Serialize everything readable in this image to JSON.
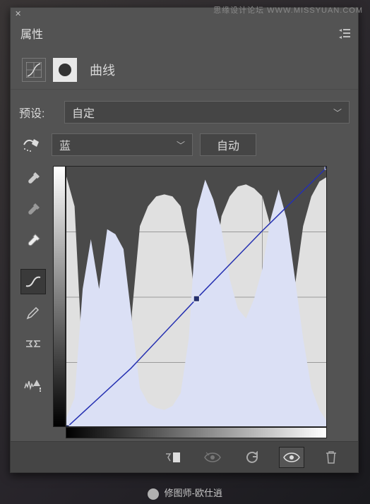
{
  "watermark": "思缘设计论坛  WWW.MISSYUAN.COM",
  "header": {
    "tab_label": "属性"
  },
  "type_row": {
    "label": "曲线"
  },
  "preset": {
    "label": "预设:",
    "value": "自定"
  },
  "channel": {
    "value": "蓝",
    "auto_label": "自动"
  },
  "tools": {
    "eyedrop_black": "black-point",
    "eyedrop_gray": "gray-point",
    "eyedrop_white": "white-point",
    "point_curve": "point-curve",
    "pencil": "draw-curve",
    "smooth": "smooth-curve",
    "clip_warn": "clipping-warn"
  },
  "footer": {
    "clip_adj": "clip-adjust",
    "view_prev": "view-prev-state",
    "reset": "reset",
    "visibility": "toggle-visibility",
    "delete": "delete"
  },
  "credit": "修图师-欧仕逍",
  "chart_data": {
    "type": "curve_histogram",
    "title": "Curves Adjustment – Blue Channel",
    "x_range": [
      0,
      255
    ],
    "y_range": [
      0,
      255
    ],
    "grid": {
      "x_divisions": 4,
      "y_divisions": 4
    },
    "histogram_top": [
      10,
      40,
      200,
      250,
      245,
      248,
      245,
      230,
      150,
      60,
      40,
      30,
      28,
      30,
      40,
      80,
      150,
      180,
      110,
      50,
      30,
      20,
      18,
      22,
      30,
      60,
      110,
      150,
      120,
      60,
      30,
      15,
      10
    ],
    "histogram_light": [
      10,
      30,
      140,
      190,
      140,
      200,
      195,
      180,
      110,
      40,
      25,
      20,
      18,
      22,
      35,
      90,
      220,
      250,
      230,
      200,
      150,
      120,
      110,
      130,
      160,
      210,
      240,
      210,
      150,
      90,
      40,
      18,
      5
    ],
    "curve_points": {
      "input": [
        0,
        63,
        127,
        191,
        255
      ],
      "output": [
        0,
        58,
        126,
        192,
        255
      ],
      "note": "Nearly linear blue curve with slight midtone dip (~-2)."
    },
    "control_handles": [
      {
        "x": 0,
        "y": 0
      },
      {
        "x": 127,
        "y": 126
      },
      {
        "x": 255,
        "y": 255
      }
    ],
    "black_point": 0,
    "white_point": 255
  }
}
